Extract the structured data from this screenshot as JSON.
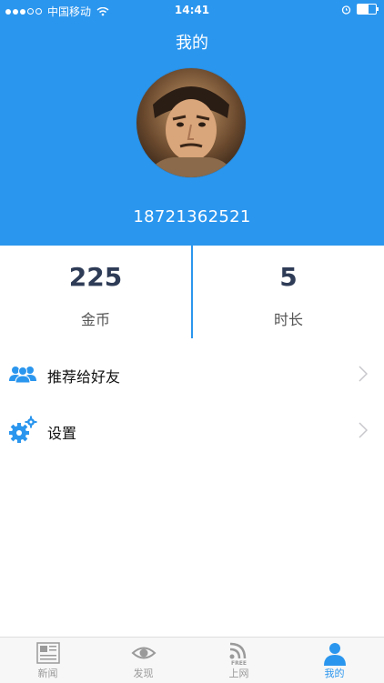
{
  "status_bar": {
    "carrier": "中国移动",
    "time": "14:41"
  },
  "header": {
    "title": "我的",
    "phone": "18721362521"
  },
  "stats": {
    "coins_value": "225",
    "coins_label": "金币",
    "time_value": "5",
    "time_label": "时长"
  },
  "menu": [
    {
      "label": "推荐给好友",
      "icon": "users-icon"
    },
    {
      "label": "设置",
      "icon": "gear-icon"
    }
  ],
  "tabs": [
    {
      "label": "新闻",
      "icon": "newspaper-icon",
      "active": false
    },
    {
      "label": "发现",
      "icon": "eye-icon",
      "active": false
    },
    {
      "label": "上网",
      "icon": "free-wifi-icon",
      "active": false
    },
    {
      "label": "我的",
      "icon": "person-icon",
      "active": true
    }
  ],
  "colors": {
    "primary": "#2b96ee",
    "tab_inactive": "#9a9a9a"
  }
}
